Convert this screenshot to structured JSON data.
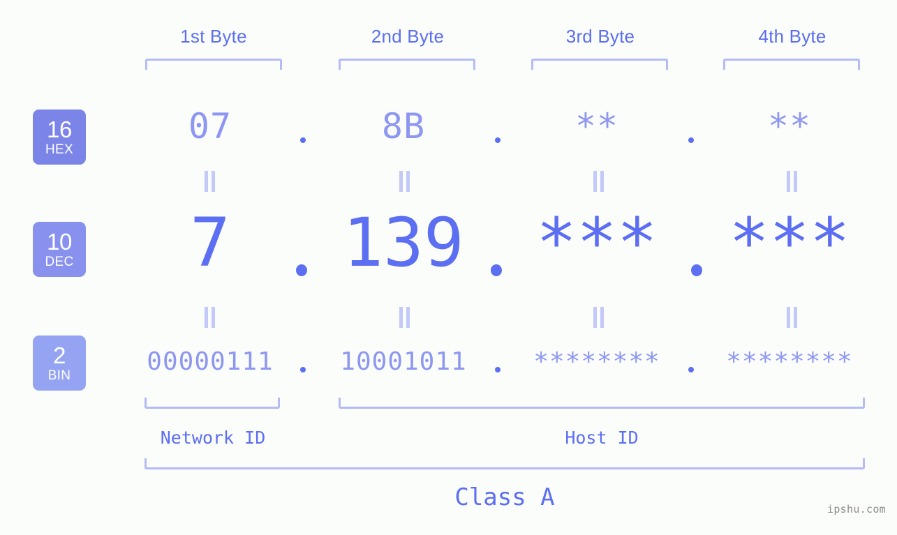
{
  "meta": {
    "background_color": "#fbfdfa",
    "accent_strong": "#5c6ef2",
    "accent_soft": "#8d96f2",
    "accent_line": "#b4bbf7",
    "accent_faint": "#c3c9f8"
  },
  "byte_headers": [
    {
      "label": "1st Byte"
    },
    {
      "label": "2nd Byte"
    },
    {
      "label": "3rd Byte"
    },
    {
      "label": "4th Byte"
    }
  ],
  "rows": [
    {
      "badge": {
        "number": "16",
        "name": "HEX",
        "color": "#7b85e8"
      },
      "values": [
        "07",
        "8B",
        "**",
        "**"
      ],
      "separator": "."
    },
    {
      "badge": {
        "number": "10",
        "name": "DEC",
        "color": "#8892ee"
      },
      "values": [
        "7",
        "139",
        "***",
        "***"
      ],
      "separator": "."
    },
    {
      "badge": {
        "number": "2",
        "name": "BIN",
        "color": "#95a3f3"
      },
      "values": [
        "00000111",
        "10001011",
        "********",
        "********"
      ],
      "separator": "."
    }
  ],
  "equals_symbol": "=",
  "segments": {
    "network_id": {
      "label": "Network ID"
    },
    "host_id": {
      "label": "Host ID"
    },
    "class": {
      "label": "Class A"
    }
  },
  "watermark": {
    "text": "ipshu.com"
  }
}
